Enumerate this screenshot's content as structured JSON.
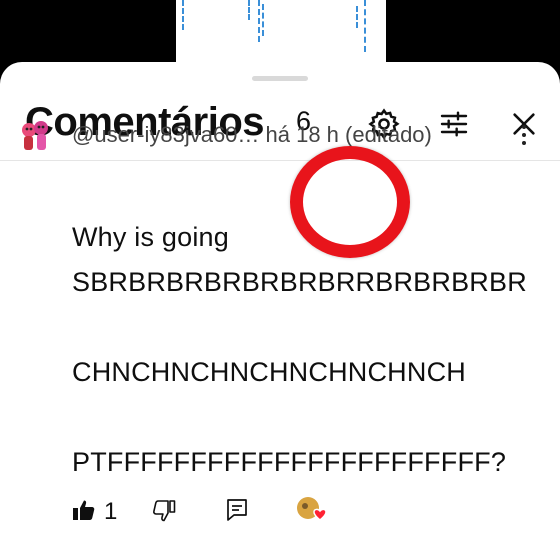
{
  "sheet": {
    "title": "Comentários",
    "comment_count": "6"
  },
  "comment": {
    "meta": "@user-iy83jva60… há 18 h (editado)",
    "lines": [
      "Why is going",
      "SBRBRBRBRBRBRBRRBRBRBRBR",
      "CHNCHNCHNCHNCHNCHNCH",
      "PTFFFFFFFFFFFFFFFFFFFFFFF?"
    ],
    "like_count": "1"
  },
  "icons": {
    "settings": "gear-icon",
    "filter": "sliders-icon",
    "close": "close-icon",
    "like": "thumbs-up-icon",
    "dislike": "thumbs-down-icon",
    "reply": "reply-icon",
    "creator_heart": "creator-heart-icon",
    "more": "more-vertical-icon"
  },
  "colors": {
    "overlay_ring": "#e8141b",
    "video_marks": "#3a8fd8"
  }
}
